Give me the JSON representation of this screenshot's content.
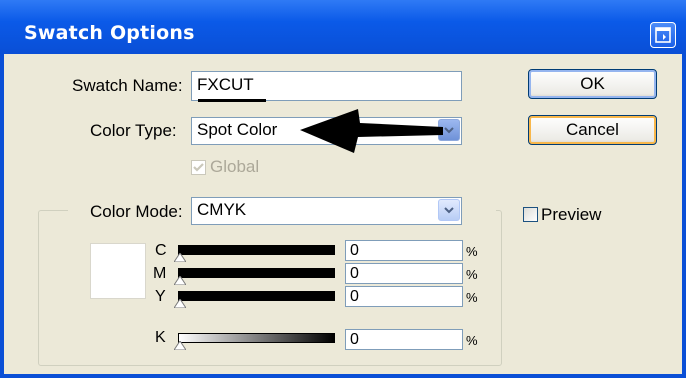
{
  "window": {
    "title": "Swatch Options",
    "control_icon": "restore-window-icon"
  },
  "fields": {
    "swatch_name_label": "Swatch Name:",
    "swatch_name_value": "FXCUT",
    "color_type_label": "Color Type:",
    "color_type_value": "Spot Color",
    "global_label": "Global",
    "global_checked": true,
    "color_mode_label": "Color Mode:",
    "color_mode_value": "CMYK"
  },
  "buttons": {
    "ok": "OK",
    "cancel": "Cancel"
  },
  "preview": {
    "label": "Preview",
    "checked": false
  },
  "channels": [
    {
      "label": "C",
      "value": "0",
      "unit": "%"
    },
    {
      "label": "M",
      "value": "0",
      "unit": "%"
    },
    {
      "label": "Y",
      "value": "0",
      "unit": "%"
    },
    {
      "label": "K",
      "value": "0",
      "unit": "%"
    }
  ],
  "colors": {
    "title_bar": "#0a4fd6",
    "dialog_bg": "#ece9d8",
    "input_border": "#7f9db9",
    "cancel_focus": "#f8b74b"
  },
  "annotation": {
    "icon": "black-arrow-annotation",
    "points_to": "color-type-select"
  }
}
